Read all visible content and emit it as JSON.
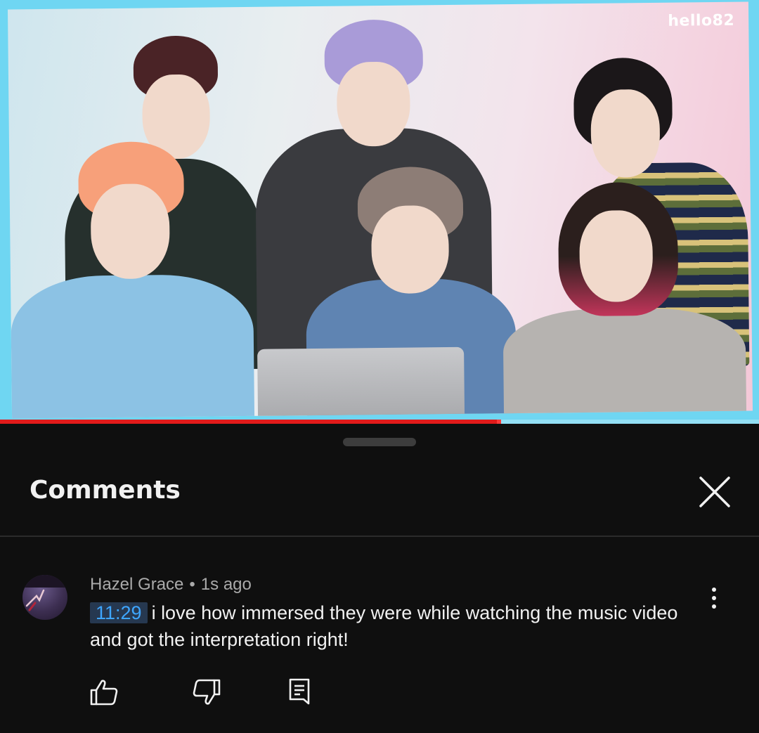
{
  "video": {
    "watermark": "hello82",
    "progress_fraction": 0.657,
    "accent_color": "#e11b1b",
    "frame_color": "#6fd6f2"
  },
  "comments_panel": {
    "title": "Comments",
    "close_icon": "close-icon",
    "comment": {
      "author": "Hazel Grace",
      "separator": "•",
      "time_ago": "1s ago",
      "timestamp_link": "11:29",
      "text": "i love how immersed they were while watching the music video and got the interpretation right!",
      "actions": [
        "like-icon",
        "dislike-icon",
        "reply-icon"
      ],
      "more_icon": "more-vertical-icon"
    }
  }
}
